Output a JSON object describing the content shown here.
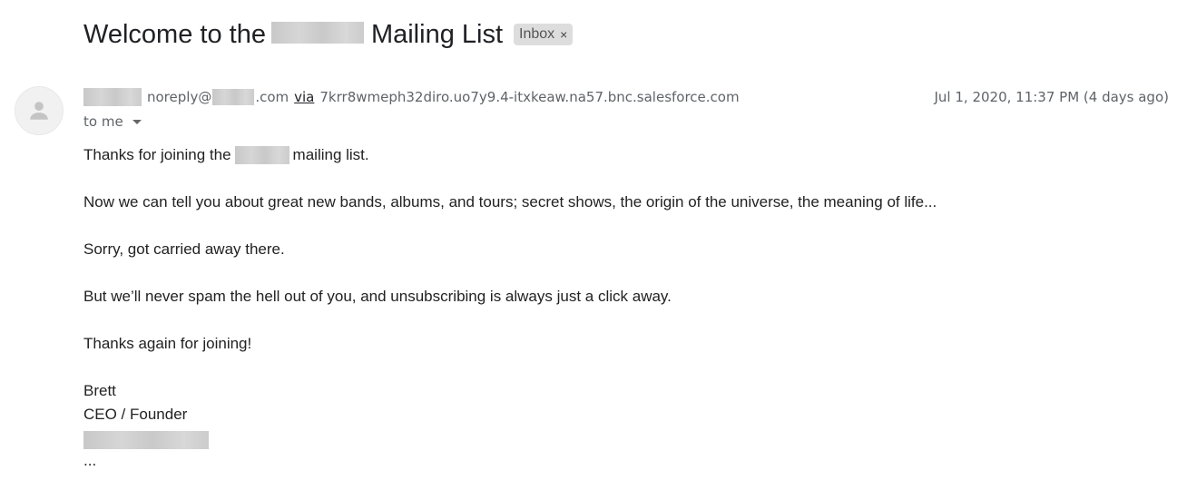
{
  "email": {
    "subject_start": "Welcome to the",
    "subject_end": "Mailing List",
    "label": "Inbox",
    "label_close": "×",
    "sender_email_prefix": "noreply@",
    "sender_email_suffix": ".com",
    "via_label": "via",
    "via_domain": "7krr8wmeph32diro.uo7y9.4-itxkeaw.na57.bnc.salesforce.com",
    "date": "Jul 1, 2020, 11:37 PM (4 days ago)",
    "recipient": "to me"
  },
  "body": {
    "p1_start": "Thanks for joining the",
    "p1_end": "mailing list.",
    "p2": "Now we can tell you about great new bands, albums, and tours; secret shows, the origin of the universe, the meaning of life...",
    "p3": "Sorry, got carried away there.",
    "p4": "But we’ll never spam the hell out of you, and unsubscribing is always just a click away.",
    "p5": "Thanks again for joining!",
    "sig_name": "Brett",
    "sig_title": "CEO / Founder",
    "trimmed": "..."
  },
  "icons": {
    "avatar": "person-avatar-icon",
    "label_close": "close-icon",
    "recipient_toggle": "caret-down-icon"
  }
}
